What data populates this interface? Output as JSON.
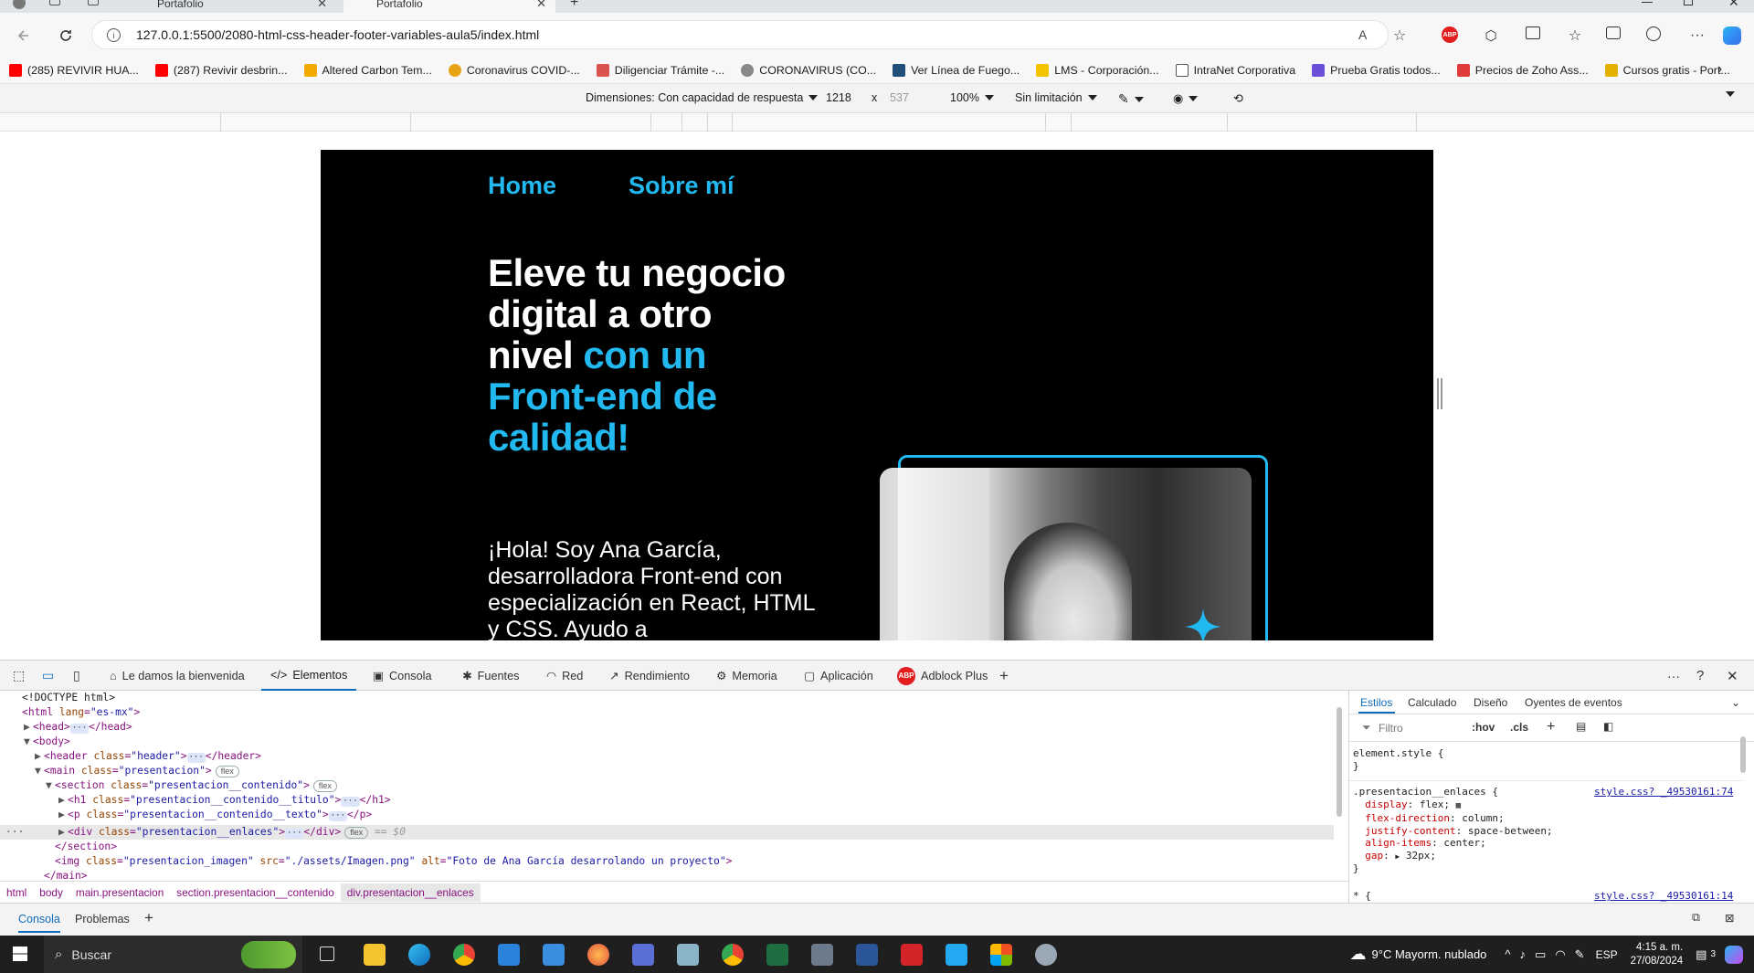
{
  "browser": {
    "tabs": [
      {
        "title": "Portafolio",
        "close": "✕"
      },
      {
        "title": "Portafolio",
        "close": "✕"
      }
    ],
    "new_tab": "+",
    "url": "127.0.0.1:5500/2080-html-css-header-footer-variables-aula5/index.html",
    "accent": "#0f6cbd"
  },
  "bookmarks": [
    {
      "label": "(285) REVIVIR HUA...",
      "color": "#ff0000"
    },
    {
      "label": "(287) Revivir desbrin...",
      "color": "#ff0000"
    },
    {
      "label": "Altered Carbon Tem...",
      "color": "#f2a900"
    },
    {
      "label": "Coronavirus COVID-...",
      "color": "#e8a317"
    },
    {
      "label": "Diligenciar Trámite -...",
      "color": "#d9534f"
    },
    {
      "label": "CORONAVIRUS (CO...",
      "color": "#888888"
    },
    {
      "label": "Ver Línea de Fuego...",
      "color": "#1f4e79"
    },
    {
      "label": "LMS - Corporación...",
      "color": "#f5c400"
    },
    {
      "label": "IntraNet Corporativa",
      "color": "#555555"
    },
    {
      "label": "Prueba Gratis todos...",
      "color": "#6c4fd8"
    },
    {
      "label": "Precios de Zoho Ass...",
      "color": "#e03a3a"
    },
    {
      "label": "Cursos gratis - Port...",
      "color": "#e3b000"
    }
  ],
  "device_toolbar": {
    "dimensions_label": "Dimensiones: Con capacidad de respuesta",
    "width": "1218",
    "times": "x",
    "height": "537",
    "zoom": "100%",
    "throttle": "Sin limitación"
  },
  "site": {
    "nav": [
      "Home",
      "Sobre mí"
    ],
    "title_white": "Eleve tu negocio digital a otro nivel ",
    "title_accent": "con un Front-end de calidad!",
    "text": "¡Hola! Soy Ana García, desarrolladora Front-end con especialización en React, HTML y CSS. Ayudo a",
    "accent": "#22b8f0"
  },
  "devtools": {
    "tabs": [
      "Le damos la bienvenida",
      "Elementos",
      "Consola",
      "Fuentes",
      "Red",
      "Rendimiento",
      "Memoria",
      "Aplicación",
      "Adblock Plus"
    ],
    "tree": {
      "doctype": "<!DOCTYPE html>",
      "html_tag": "html",
      "html_attr": "lang",
      "html_val": "\"es-mx\"",
      "head": "<head>",
      "head_close": "</head>",
      "body": "<body>",
      "header_tag": "header",
      "header_val": "\"header\"",
      "header_close": "</header>",
      "main_tag": "main",
      "main_val": "\"presentacion\"",
      "section_tag": "section",
      "section_val": "\"presentacion__contenido\"",
      "h1_tag": "h1",
      "h1_val": "\"presentacion__contenido__titulo\"",
      "h1_close": "</h1>",
      "p_tag": "p",
      "p_val": "\"presentacion__contenido__texto\"",
      "p_close": "</p>",
      "div_tag": "div",
      "div_val": "\"presentacion__enlaces\"",
      "div_close": "</div>",
      "section_close": "</section>",
      "img_tag": "img",
      "img_class": "\"presentacion_imagen\"",
      "img_src": "\"./assets/Imagen.png\"",
      "img_alt": "\"Foto de Ana García desarrolando un proyecto\"",
      "main_close": "</main>",
      "class_attr": "class",
      "src_attr": "src",
      "alt_attr": "alt",
      "flex_badge": "flex",
      "selected_marker": "== $0",
      "ellipsis": "···"
    },
    "breadcrumbs": [
      "html",
      "body",
      "main.presentacion",
      "section.presentacion__contenido",
      "div.presentacion__enlaces"
    ],
    "styles_tabs": [
      "Estilos",
      "Calculado",
      "Diseño",
      "Oyentes de eventos"
    ],
    "filter_placeholder": "Filtro",
    "hov": ":hov",
    "cls": ".cls",
    "element_style": "element.style {",
    "close_brace": "}",
    "rule_selector": ".presentacion__enlaces {",
    "rule_link": "style.css? _49530161:74",
    "rule_link2": "style.css? _49530161:14",
    "star_rule": "* {",
    "decls": [
      {
        "prop": "display",
        "val": "flex;"
      },
      {
        "prop": "flex-direction",
        "val": "column;"
      },
      {
        "prop": "justify-content",
        "val": "space-between;"
      },
      {
        "prop": "align-items",
        "val": "center;"
      },
      {
        "prop": "gap",
        "val": "32px;"
      }
    ],
    "drawer_tabs": [
      "Consola",
      "Problemas"
    ]
  },
  "taskbar": {
    "search": "Buscar",
    "weather": "9°C  Mayorm. nublado",
    "lang": "ESP",
    "time": "4:15 a. m.",
    "date": "27/08/2024",
    "notif_count": "3"
  }
}
